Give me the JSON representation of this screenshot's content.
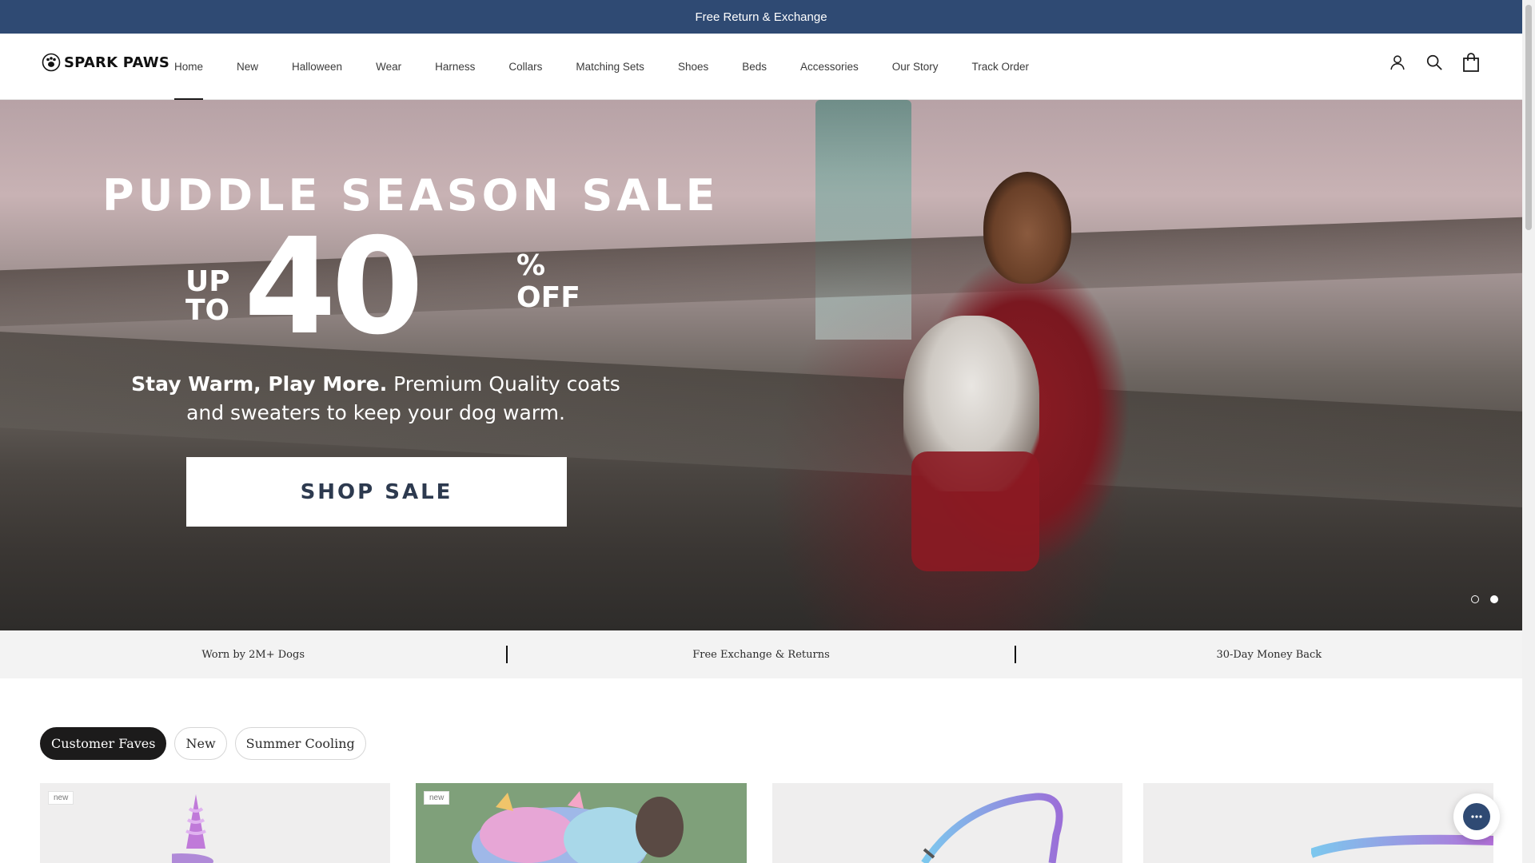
{
  "announcement": {
    "text": "Free Return & Exchange"
  },
  "header": {
    "logo_text": "SPARK PAWS",
    "nav": [
      "Home",
      "New",
      "Halloween",
      "Wear",
      "Harness",
      "Collars",
      "Matching Sets",
      "Shoes",
      "Beds",
      "Accessories",
      "Our Story",
      "Track Order"
    ],
    "active_nav": "Home",
    "icons": [
      "account-icon",
      "search-icon",
      "cart-icon"
    ]
  },
  "hero": {
    "title": "PUDDLE SEASON SALE",
    "up": "UP",
    "to": "TO",
    "number": "40",
    "percent": "%",
    "off": "OFF",
    "subtitle_bold": "Stay Warm, Play More.",
    "subtitle_rest": " Premium Quality coats and sweaters to keep your dog warm.",
    "cta": "SHOP SALE",
    "slides": 2,
    "active_slide": 2
  },
  "trust_bar": [
    "Worn by 2M+ Dogs",
    "Free Exchange & Returns",
    "30-Day Money Back"
  ],
  "collection_tabs": {
    "items": [
      "Customer Faves",
      "New",
      "Summer Cooling"
    ],
    "active": "Customer Faves"
  },
  "products": [
    {
      "badge": "new"
    },
    {
      "badge": "new"
    },
    {
      "badge": ""
    },
    {
      "badge": ""
    }
  ],
  "colors": {
    "announcement_bg": "#2f4a73",
    "hero_cta_text": "#2d3a4f",
    "active_tab_bg": "#1c1b1b"
  }
}
